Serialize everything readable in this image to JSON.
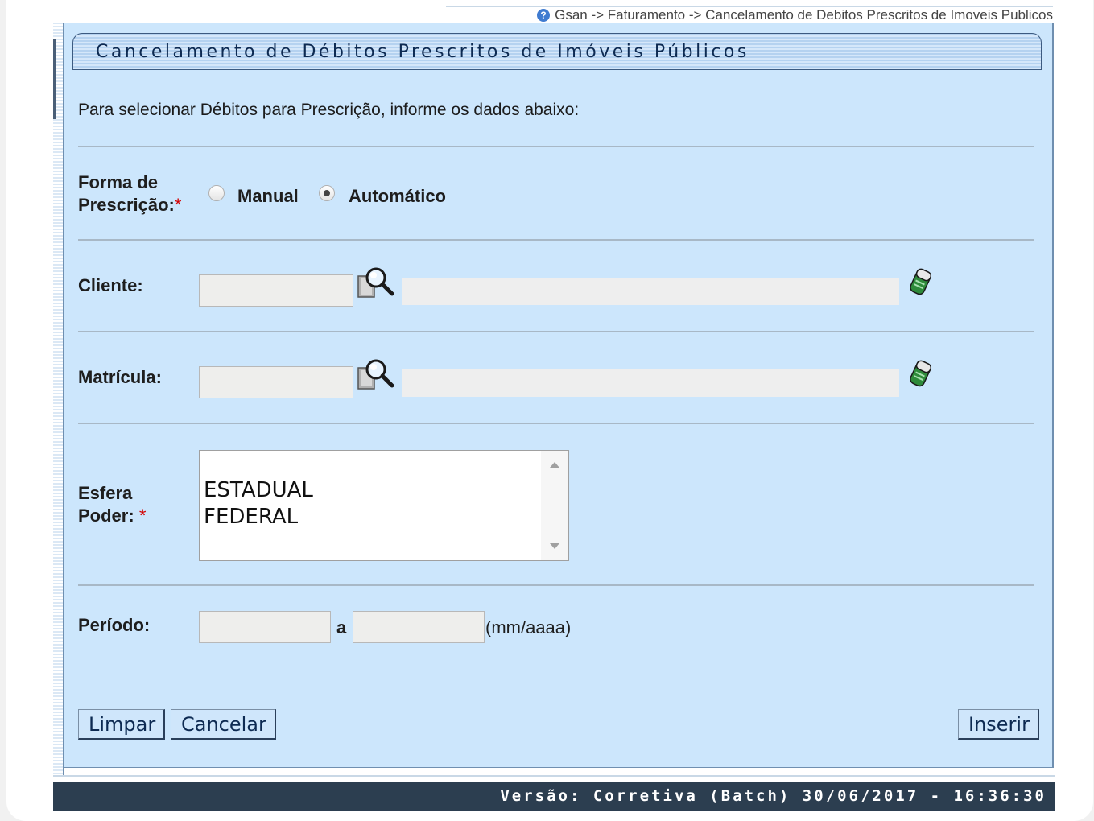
{
  "breadcrumb": {
    "text": "Gsan -> Faturamento -> Cancelamento de Debitos Prescritos de Imoveis Publicos",
    "icon": "help-icon"
  },
  "title": "Cancelamento de Débitos Prescritos de Imóveis Públicos",
  "intro": "Para selecionar Débitos para Prescrição, informe os dados abaixo:",
  "forma": {
    "label_line1": "Forma de",
    "label_line2": "Prescrição:",
    "required_mark": "*",
    "options": [
      {
        "label": "Manual",
        "checked": false
      },
      {
        "label": "Automático",
        "checked": true
      }
    ]
  },
  "cliente": {
    "label": "Cliente:",
    "code_value": "",
    "name_value": ""
  },
  "matricula": {
    "label": "Matrícula:",
    "code_value": "",
    "name_value": ""
  },
  "esfera": {
    "label_line1": "Esfera",
    "label_line2": "Poder:",
    "required_mark": "*",
    "options": [
      "ESTADUAL",
      "FEDERAL"
    ]
  },
  "periodo": {
    "label": "Período:",
    "start_value": "",
    "separator": "a",
    "end_value": "",
    "format_hint": "(mm/aaaa)"
  },
  "buttons": {
    "limpar": "Limpar",
    "cancelar": "Cancelar",
    "inserir": "Inserir"
  },
  "footer": {
    "version": "Versão: Corretiva (Batch) 30/06/2017 - 16:36:30"
  },
  "colors": {
    "panel_bg": "#cce6fc",
    "title_text": "#0d2a52",
    "footer_bg": "#2c3e50",
    "required": "#d40000"
  }
}
